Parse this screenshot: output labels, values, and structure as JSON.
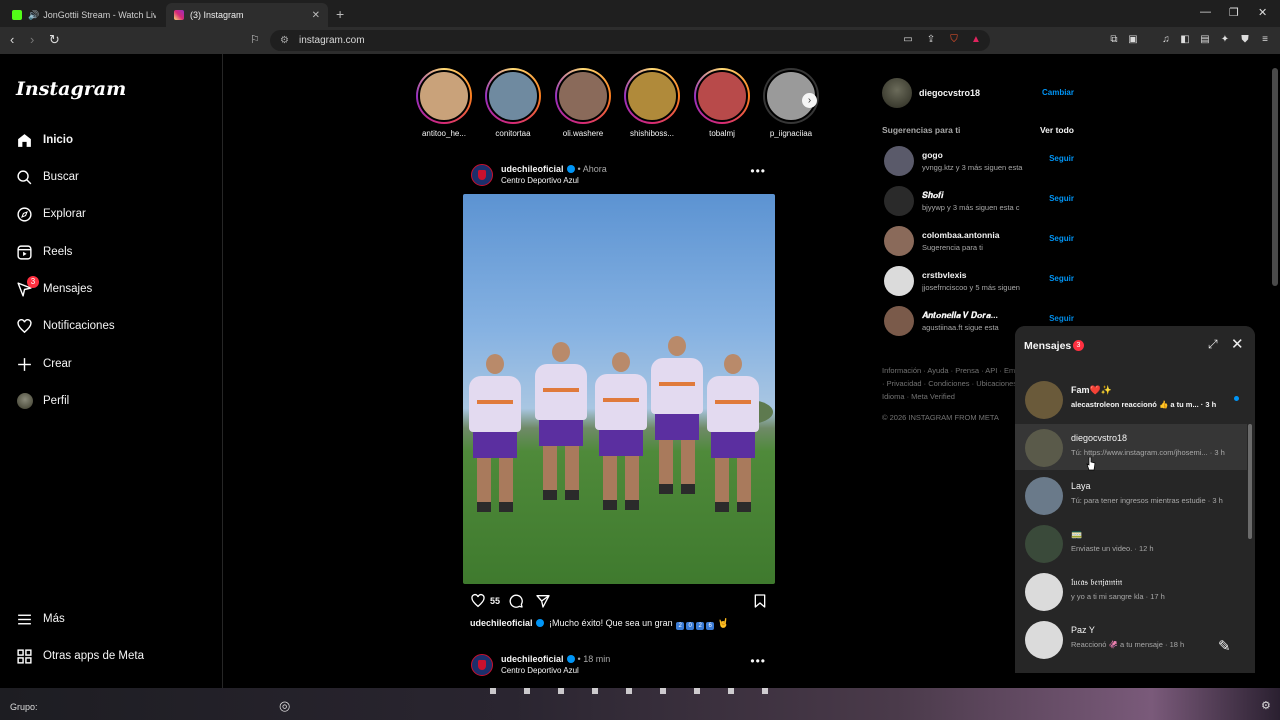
{
  "browser": {
    "tabs": [
      {
        "title": "JonGottii Stream - Watch Live on",
        "favicon_color": "#53fc18"
      },
      {
        "title": "(3) Instagram",
        "favicon_color": "#d62976"
      }
    ],
    "url": "instagram.com"
  },
  "nav": {
    "logo": "Instagram",
    "items": [
      {
        "label": "Inicio",
        "icon": "home-icon"
      },
      {
        "label": "Buscar",
        "icon": "search-icon"
      },
      {
        "label": "Explorar",
        "icon": "compass-icon"
      },
      {
        "label": "Reels",
        "icon": "reels-icon"
      },
      {
        "label": "Mensajes",
        "icon": "messenger-icon",
        "badge": "3"
      },
      {
        "label": "Notificaciones",
        "icon": "heart-icon"
      },
      {
        "label": "Crear",
        "icon": "plus-icon"
      },
      {
        "label": "Perfil",
        "icon": "avatar"
      }
    ],
    "more": "Más",
    "meta_apps": "Otras apps de Meta"
  },
  "stories": [
    {
      "username": "antitoo_he...",
      "seen": false,
      "color": "#c9a27a"
    },
    {
      "username": "conitortaa",
      "seen": false,
      "color": "#6f8aa0"
    },
    {
      "username": "oli.washere",
      "seen": false,
      "color": "#8a6a5a"
    },
    {
      "username": "shishiboss...",
      "seen": false,
      "color": "#b08a3a"
    },
    {
      "username": "tobalmj",
      "seen": false,
      "color": "#b84a4a"
    },
    {
      "username": "p_iignaciiaa",
      "seen": true,
      "color": "#9a9a9a"
    }
  ],
  "post": {
    "username": "udechileoficial",
    "time": "Ahora",
    "location": "Centro Deportivo Azul",
    "likes": "55",
    "caption": "¡Mucho éxito! Que sea un gran",
    "caption_digits": [
      "2",
      "0",
      "2",
      "6"
    ]
  },
  "post2": {
    "username": "udechileoficial",
    "time": "18 min",
    "location": "Centro Deportivo Azul"
  },
  "me": {
    "username": "diegocvstro18",
    "switch": "Cambiar"
  },
  "suggestions": {
    "title": "Sugerencias para ti",
    "see_all": "Ver todo",
    "follow_label": "Seguir",
    "items": [
      {
        "username": "gogo",
        "sub": "yvngg.ktz y 3 más siguen esta",
        "color": "#5a5a6a"
      },
      {
        "username": "𝑺𝒉𝒐𝒇𝒊",
        "sub": "bjyywp y 3 más siguen esta c",
        "color": "#2a2a2a"
      },
      {
        "username": "colombaa.antonnia",
        "sub": "Sugerencia para ti",
        "color": "#8a6a5a"
      },
      {
        "username": "crstbvlexis",
        "sub": "jjosefrnciscoo y 5 más siguen",
        "color": "#dbdbdb"
      },
      {
        "username": "𝑨𝒏𝒕𝒐𝒏𝒆𝒍𝒍𝒂 𝑽 𝑫𝒐𝒓𝒂...",
        "sub": "agustiinaa.ft sigue esta",
        "color": "#7a5a4a"
      }
    ]
  },
  "footer": {
    "links": "Información · Ayuda · Prensa · API · Empleo · Privacidad · Condiciones · Ubicaciones · Idioma · Meta Verified",
    "copyright": "© 2026 INSTAGRAM FROM META"
  },
  "messages": {
    "title": "Mensajes",
    "count": "3",
    "conversations": [
      {
        "name": "Fam❤️✨",
        "preview": "alecastroleon reaccionó 👍 a tu m...",
        "time": "3 h",
        "unread": true,
        "color": "#6a5a3a"
      },
      {
        "name": "diegocvstro18",
        "preview": "Tú: https://www.instagram.com/jhosemi...",
        "time": "3 h",
        "unread": false,
        "color": "#5a5a4a"
      },
      {
        "name": "Laya",
        "preview": "Tú: para tener ingresos mientras estudie",
        "time": "3 h",
        "unread": false,
        "color": "#6a7a8a"
      },
      {
        "name": "🚃",
        "preview": "Enviaste un video.",
        "time": "12 h",
        "unread": false,
        "color": "#3a4a3a"
      },
      {
        "name": "𝔩𝔲𝔠𝔞𝔰 𝔟𝔢𝔫𝔧𝔞𝔪𝔦𝔫",
        "preview": "y yo a ti mi sangre kla",
        "time": "17 h",
        "unread": false,
        "color": "#dbdbdb"
      },
      {
        "name": "Paz Y",
        "preview": "Reaccionó 🦑 a tu mensaje",
        "time": "18 h",
        "unread": false,
        "color": "#dbdbdb"
      }
    ]
  },
  "taskbar": {
    "group_label": "Grupo:"
  }
}
